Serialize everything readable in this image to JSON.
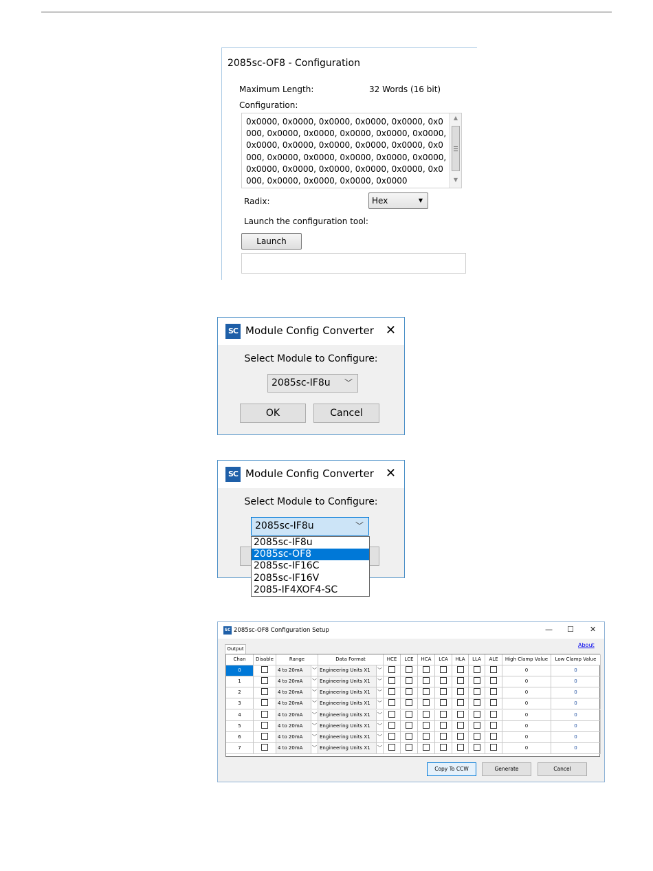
{
  "config_panel": {
    "title": "2085sc-OF8 - Configuration",
    "max_length_label": "Maximum Length:",
    "max_length_value": "32 Words (16 bit)",
    "configuration_label": "Configuration:",
    "configuration_value": "0x0000, 0x0000, 0x0000, 0x0000, 0x0000, 0x0000, 0x0000, 0x0000, 0x0000, 0x0000, 0x0000, 0x0000, 0x0000, 0x0000, 0x0000, 0x0000, 0x0000, 0x0000, 0x0000, 0x0000, 0x0000, 0x0000, 0x0000, 0x0000, 0x0000, 0x0000, 0x0000, 0x0000, 0x0000, 0x0000, 0x0000, 0x0000",
    "radix_label": "Radix:",
    "radix_value": "Hex",
    "launch_prompt": "Launch the configuration tool:",
    "launch_button": "Launch"
  },
  "dialog1": {
    "title": "Module Config Converter",
    "prompt": "Select Module to Configure:",
    "selected": "2085sc-IF8u",
    "ok": "OK",
    "cancel": "Cancel"
  },
  "dialog2": {
    "title": "Module Config Converter",
    "prompt": "Select Module to Configure:",
    "selected": "2085sc-IF8u",
    "options": [
      "2085sc-IF8u",
      "2085sc-OF8",
      "2085sc-IF16C",
      "2085sc-IF16V",
      "2085-IF4XOF4-SC"
    ],
    "highlighted_index": 1
  },
  "setup": {
    "title": "2085sc-OF8 Configuration Setup",
    "tab": "Output",
    "about": "About",
    "columns": [
      "Chan",
      "Disable",
      "Range",
      "Data Format",
      "HCE",
      "LCE",
      "HCA",
      "LCA",
      "HLA",
      "LLA",
      "ALE",
      "High Clamp Value",
      "Low Clamp Value"
    ],
    "rows": [
      {
        "chan": "0",
        "range": "4 to 20mA",
        "format": "Engineering Units X1",
        "high": "0",
        "low": "0"
      },
      {
        "chan": "1",
        "range": "4 to 20mA",
        "format": "Engineering Units X1",
        "high": "0",
        "low": "0"
      },
      {
        "chan": "2",
        "range": "4 to 20mA",
        "format": "Engineering Units X1",
        "high": "0",
        "low": "0"
      },
      {
        "chan": "3",
        "range": "4 to 20mA",
        "format": "Engineering Units X1",
        "high": "0",
        "low": "0"
      },
      {
        "chan": "4",
        "range": "4 to 20mA",
        "format": "Engineering Units X1",
        "high": "0",
        "low": "0"
      },
      {
        "chan": "5",
        "range": "4 to 20mA",
        "format": "Engineering Units X1",
        "high": "0",
        "low": "0"
      },
      {
        "chan": "6",
        "range": "4 to 20mA",
        "format": "Engineering Units X1",
        "high": "0",
        "low": "0"
      },
      {
        "chan": "7",
        "range": "4 to 20mA",
        "format": "Engineering Units X1",
        "high": "0",
        "low": "0"
      }
    ],
    "buttons": {
      "copy": "Copy To CCW",
      "generate": "Generate",
      "cancel": "Cancel"
    }
  }
}
